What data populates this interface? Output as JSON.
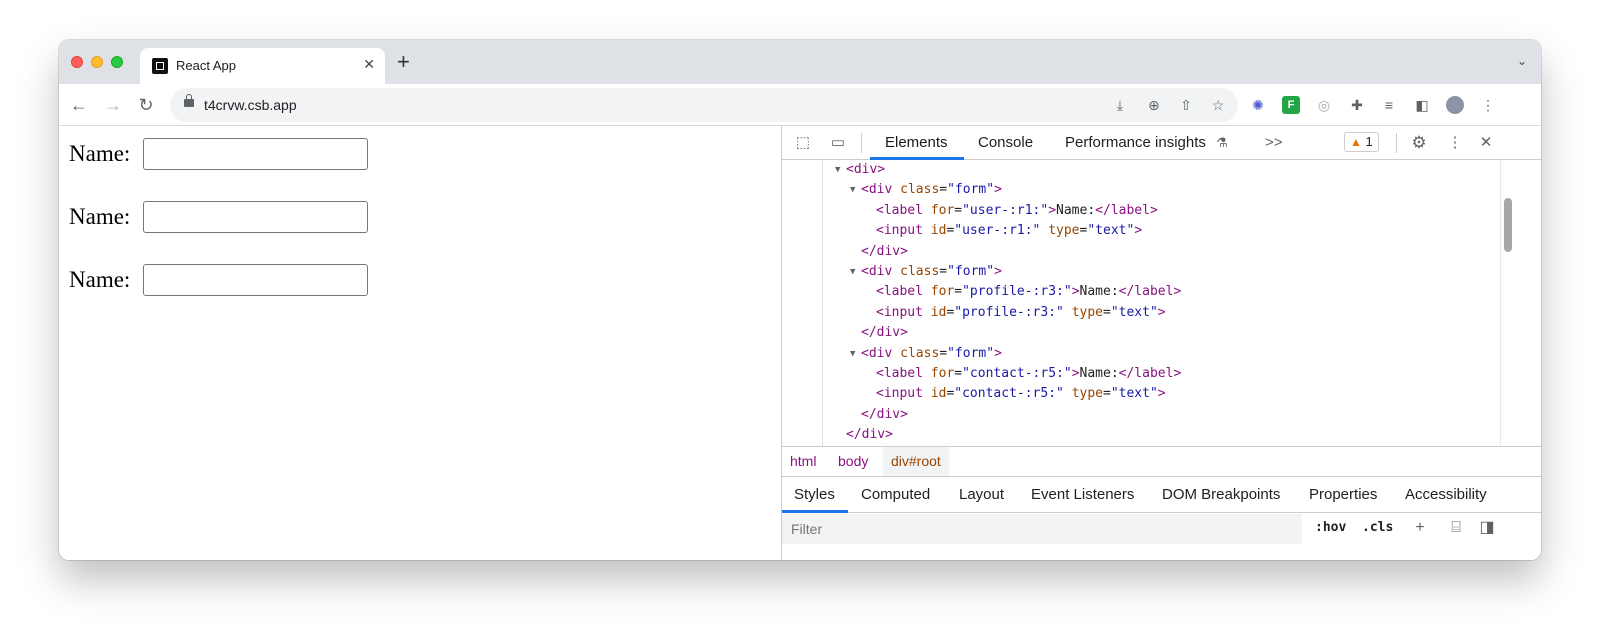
{
  "browser": {
    "tab_title": "React App",
    "tab_close": "✕",
    "new_tab": "+",
    "url": "t4crvw.csb.app",
    "tab_menu": "⌄"
  },
  "page": {
    "forms": [
      {
        "label": "Name:",
        "value": ""
      },
      {
        "label": "Name:",
        "value": ""
      },
      {
        "label": "Name:",
        "value": ""
      }
    ]
  },
  "devtools": {
    "tabs": [
      "Elements",
      "Console",
      "Performance insights",
      ">>"
    ],
    "warning_count": "1",
    "dom": [
      {
        "t": "<div>"
      },
      {
        "open": "div",
        "attrs": [
          [
            "class",
            "form"
          ]
        ]
      },
      {
        "tag": "label",
        "attrs": [
          [
            "for",
            "user-:r1:"
          ]
        ],
        "text": "Name:"
      },
      {
        "tag": "input",
        "attrs": [
          [
            "id",
            "user-:r1:"
          ],
          [
            "type",
            "text"
          ]
        ]
      },
      {
        "t": "</div>"
      },
      {
        "open": "div",
        "attrs": [
          [
            "class",
            "form"
          ]
        ]
      },
      {
        "tag": "label",
        "attrs": [
          [
            "for",
            "profile-:r3:"
          ]
        ],
        "text": "Name:"
      },
      {
        "tag": "input",
        "attrs": [
          [
            "id",
            "profile-:r3:"
          ],
          [
            "type",
            "text"
          ]
        ]
      },
      {
        "t": "</div>"
      },
      {
        "open": "div",
        "attrs": [
          [
            "class",
            "form"
          ]
        ]
      },
      {
        "tag": "label",
        "attrs": [
          [
            "for",
            "contact-:r5:"
          ]
        ],
        "text": "Name:"
      },
      {
        "tag": "input",
        "attrs": [
          [
            "id",
            "contact-:r5:"
          ],
          [
            "type",
            "text"
          ]
        ]
      },
      {
        "t": "</div>"
      },
      {
        "t": "</div>"
      }
    ],
    "breadcrumbs": [
      "html",
      "body",
      "div#root"
    ],
    "styles_tabs": [
      "Styles",
      "Computed",
      "Layout",
      "Event Listeners",
      "DOM Breakpoints",
      "Properties",
      "Accessibility"
    ],
    "filter_placeholder": "Filter",
    "hov": ":hov",
    "cls": ".cls"
  }
}
